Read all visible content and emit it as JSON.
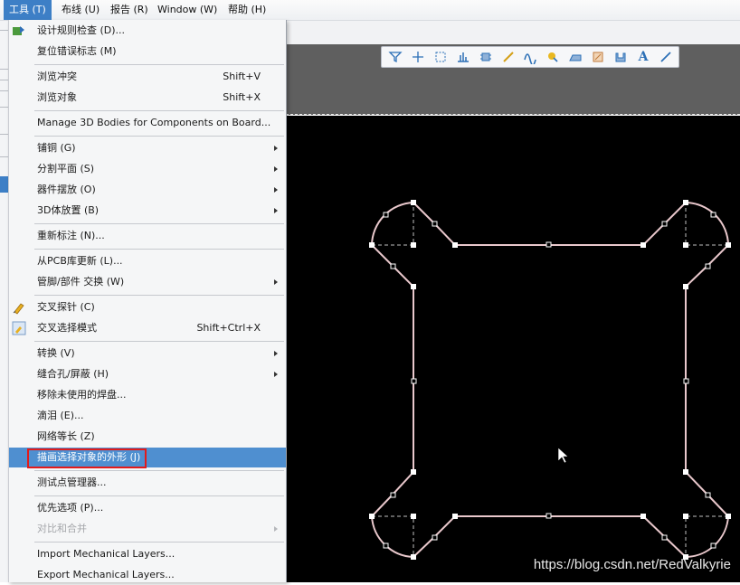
{
  "menubar": {
    "items": [
      {
        "label": "工具 (T)"
      },
      {
        "label": "布线 (U)"
      },
      {
        "label": "报告 (R)"
      },
      {
        "label": "Window (W)"
      },
      {
        "label": "帮助 (H)"
      }
    ]
  },
  "menu": {
    "items": [
      {
        "label": "设计规则检查 (D)...",
        "shortcut": "",
        "submenu": false
      },
      {
        "label": "复位错误标志 (M)",
        "shortcut": "",
        "submenu": false
      },
      {
        "label": "浏览冲突",
        "shortcut": "Shift+V",
        "submenu": false
      },
      {
        "label": "浏览对象",
        "shortcut": "Shift+X",
        "submenu": false
      },
      {
        "label": "Manage 3D Bodies for Components on Board...",
        "shortcut": "",
        "submenu": false
      },
      {
        "label": "铺铜 (G)",
        "shortcut": "",
        "submenu": true
      },
      {
        "label": "分割平面 (S)",
        "shortcut": "",
        "submenu": true
      },
      {
        "label": "器件摆放 (O)",
        "shortcut": "",
        "submenu": true
      },
      {
        "label": "3D体放置 (B)",
        "shortcut": "",
        "submenu": true
      },
      {
        "label": "重新标注 (N)...",
        "shortcut": "",
        "submenu": false
      },
      {
        "label": "从PCB库更新 (L)...",
        "shortcut": "",
        "submenu": false
      },
      {
        "label": "管脚/部件 交换 (W)",
        "shortcut": "",
        "submenu": true
      },
      {
        "label": "交叉探针 (C)",
        "shortcut": "",
        "submenu": false
      },
      {
        "label": "交叉选择模式",
        "shortcut": "Shift+Ctrl+X",
        "submenu": false
      },
      {
        "label": "转换 (V)",
        "shortcut": "",
        "submenu": true
      },
      {
        "label": "缝合孔/屏蔽 (H)",
        "shortcut": "",
        "submenu": true
      },
      {
        "label": "移除未使用的焊盘...",
        "shortcut": "",
        "submenu": false
      },
      {
        "label": "滴泪 (E)...",
        "shortcut": "",
        "submenu": false
      },
      {
        "label": "网络等长 (Z)",
        "shortcut": "",
        "submenu": false
      },
      {
        "label": "描画选择对象的外形 (J)",
        "shortcut": "",
        "submenu": false,
        "highlighted": true
      },
      {
        "label": "测试点管理器...",
        "shortcut": "",
        "submenu": false
      },
      {
        "label": "优先选项 (P)...",
        "shortcut": "",
        "submenu": false
      },
      {
        "label": "对比和合并",
        "shortcut": "",
        "submenu": true,
        "disabled": true
      },
      {
        "label": "Import Mechanical Layers...",
        "shortcut": "",
        "submenu": false
      },
      {
        "label": "Export Mechanical Layers...",
        "shortcut": "",
        "submenu": false
      }
    ]
  },
  "pcb_toolbar": {
    "icons": [
      "filter-icon",
      "crosshair-icon",
      "select-rect-icon",
      "align-icon",
      "component-icon",
      "route-icon",
      "interactive-route-icon",
      "pad-icon",
      "polygon-icon",
      "region-icon",
      "keepout-icon",
      "text-icon",
      "line-icon"
    ],
    "text_glyph": "A"
  },
  "colors": {
    "accent": "#3d7fc6",
    "highlight": "#4f8fd0",
    "canvas": "#000000",
    "outline": "#e9c8cc",
    "red_box": "#e21b1b"
  },
  "watermark": "https://blog.csdn.net/RedValkyrie"
}
